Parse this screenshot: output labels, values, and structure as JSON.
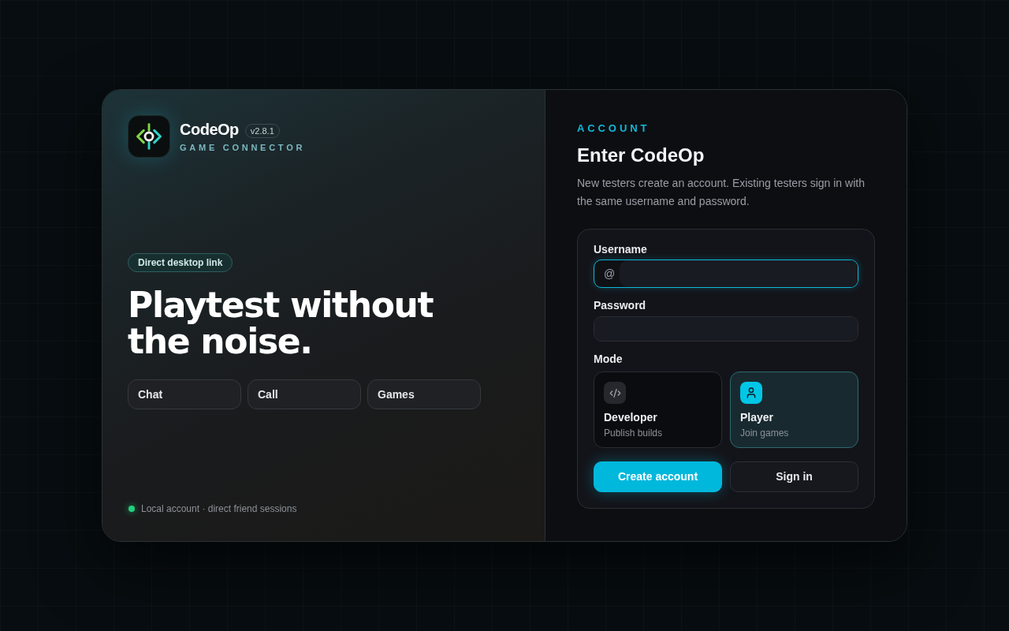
{
  "brand": {
    "name": "CodeOp",
    "version": "v2.8.1",
    "tagline": "GAME CONNECTOR"
  },
  "hero": {
    "badge": "Direct desktop link",
    "headline": "Playtest without the noise.",
    "features": [
      {
        "label": "Chat"
      },
      {
        "label": "Call"
      },
      {
        "label": "Games"
      }
    ]
  },
  "status": {
    "online": true,
    "text": "Local account · direct friend sessions"
  },
  "form": {
    "eyebrow": "ACCOUNT",
    "title": "Enter CodeOp",
    "description": "New testers create an account. Existing testers sign in with the same username and password.",
    "fields": [
      {
        "label": "Username",
        "prefix": "@",
        "focused": true
      },
      {
        "label": "Password",
        "focused": false
      }
    ],
    "mode": {
      "label": "Mode",
      "options": [
        {
          "kind": "developer",
          "title": "Developer",
          "subtitle": "Publish builds",
          "selected": false
        },
        {
          "kind": "player",
          "title": "Player",
          "subtitle": "Join games",
          "selected": true
        }
      ]
    },
    "buttons": [
      {
        "label": "Create account",
        "primary": true
      },
      {
        "label": "Sign in",
        "primary": false
      }
    ]
  }
}
